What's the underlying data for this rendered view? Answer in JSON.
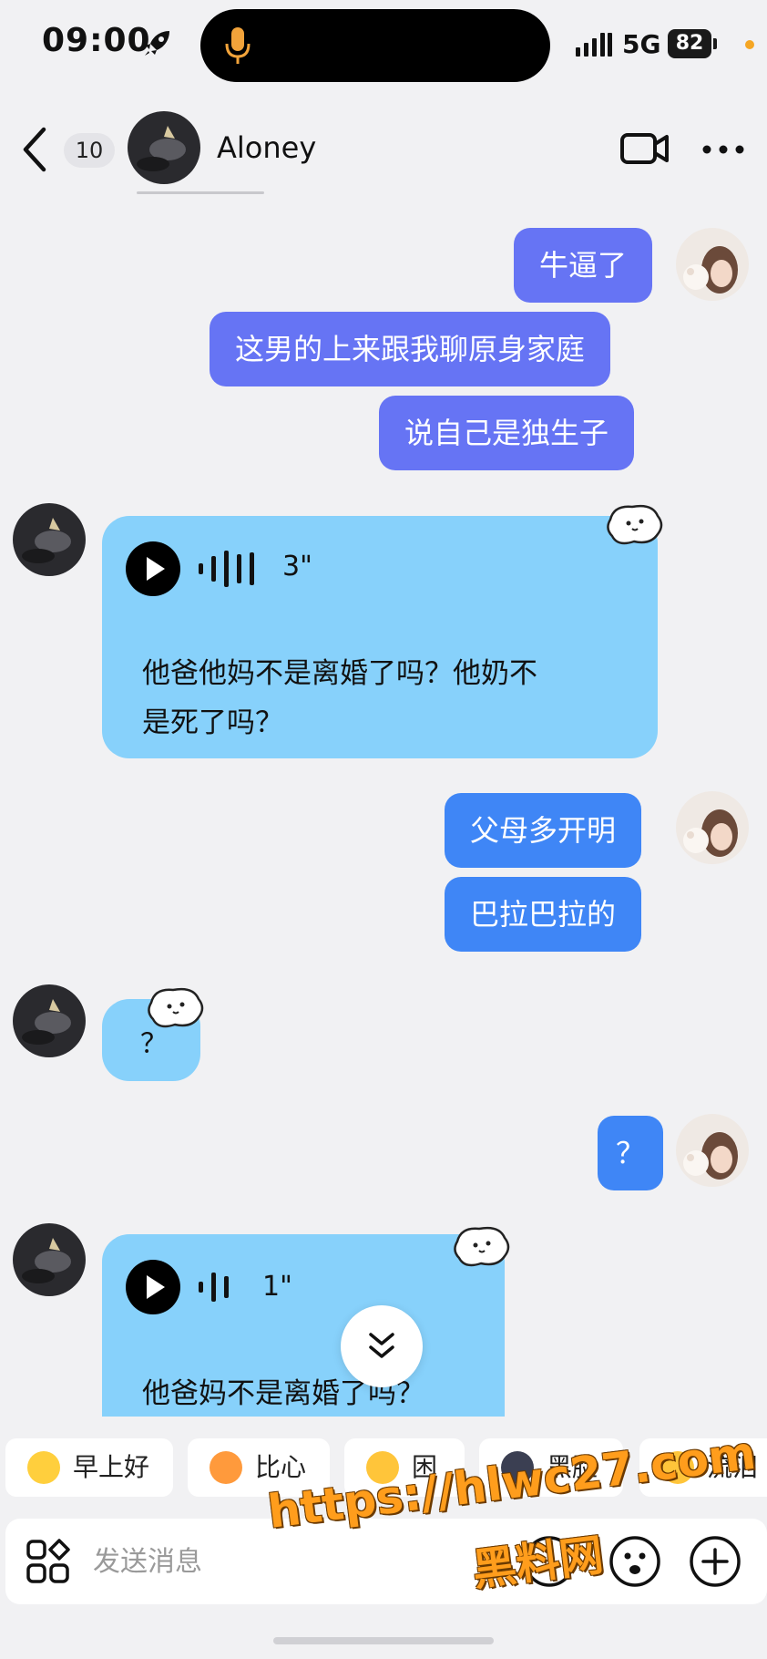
{
  "status_bar": {
    "time": "09:00",
    "network": "5G",
    "battery": "82",
    "accent_dot_color": "#f5a623"
  },
  "header": {
    "unread_count": "10",
    "contact_name": "Aloney",
    "icons": [
      "back-arrow-icon",
      "video-call-icon",
      "more-icon"
    ]
  },
  "messages": [
    {
      "side": "out",
      "text": "牛逼了",
      "color": "#6674f4"
    },
    {
      "side": "out",
      "text": "这男的上来跟我聊原身家庭",
      "color": "#6674f4"
    },
    {
      "side": "out",
      "text": "说自己是独生子",
      "color": "#6674f4"
    },
    {
      "side": "in",
      "type": "voice",
      "duration": "3\"",
      "lines": [
        "他爸他妈不是离婚了吗？他奶不",
        "是死了吗？"
      ]
    },
    {
      "side": "out",
      "text": "父母多开明",
      "color": "#3f86f6"
    },
    {
      "side": "out",
      "text": "巴拉巴拉的",
      "color": "#3f86f6"
    },
    {
      "side": "in",
      "text": "？"
    },
    {
      "side": "out",
      "text": "？",
      "color": "#3f86f6"
    },
    {
      "side": "in",
      "type": "voice",
      "duration": "1\"",
      "lines": [
        "他爸妈不是离婚了吗？"
      ]
    }
  ],
  "quick_replies": [
    {
      "label": "早上好",
      "icon": "sun-sunglasses-emoji-icon"
    },
    {
      "label": "比心",
      "icon": "heart-hands-emoji-icon"
    },
    {
      "label": "困",
      "icon": "sleepy-emoji-icon"
    },
    {
      "label": "黑脸",
      "icon": "dark-face-emoji-icon"
    },
    {
      "label": "流泪",
      "icon": "crying-emoji-icon"
    }
  ],
  "input": {
    "placeholder": "发送消息"
  },
  "watermark": {
    "url": "https://hlwc27.com",
    "name": "黑料网"
  },
  "colors": {
    "background": "#f1f1f3",
    "incoming_bubble": "#87d1fb",
    "outgoing_purple": "#6674f4",
    "outgoing_blue": "#3f86f6"
  }
}
